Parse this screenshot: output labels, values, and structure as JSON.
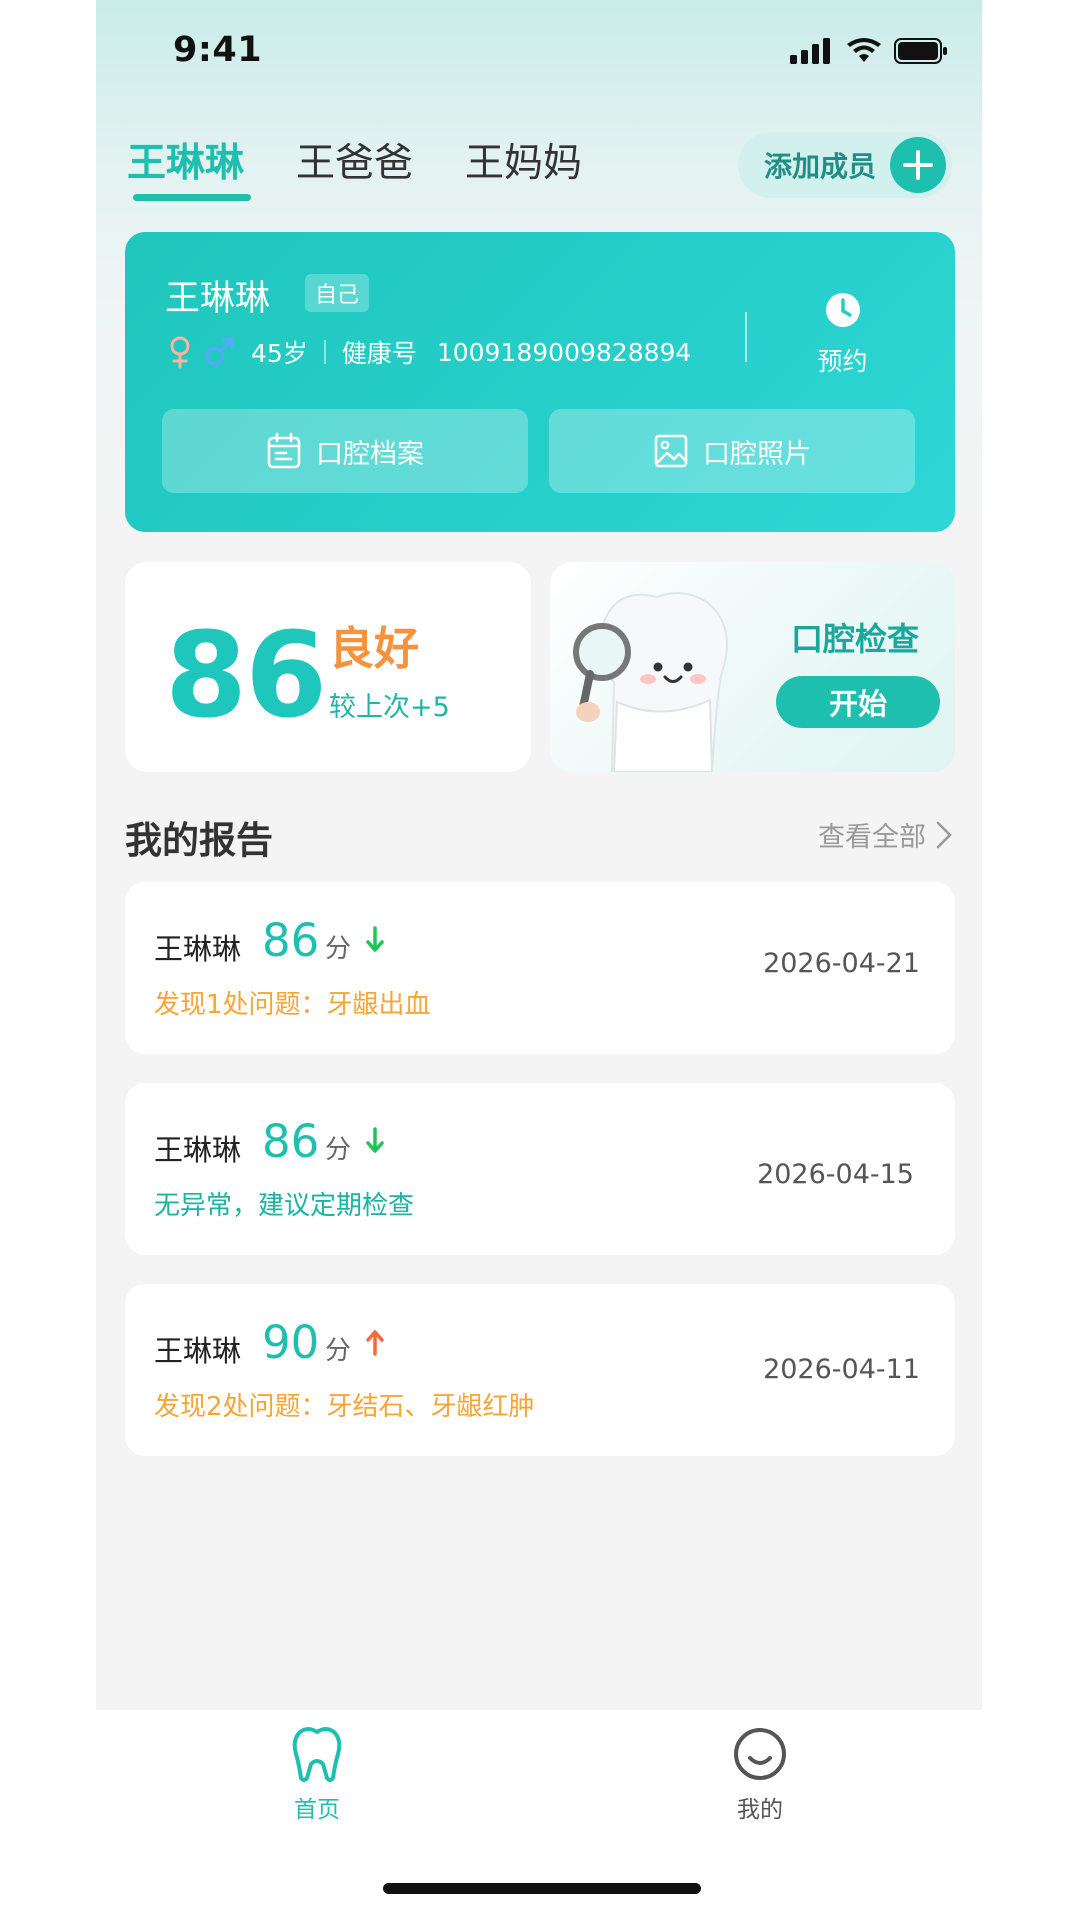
{
  "status_bar": {
    "time": "9:41"
  },
  "tabs": [
    {
      "label": "王琳琳",
      "active": true
    },
    {
      "label": "王爸爸",
      "active": false
    },
    {
      "label": "王妈妈",
      "active": false
    }
  ],
  "add_member": {
    "label": "添加成员"
  },
  "profile": {
    "name": "王琳琳",
    "tag": "自己",
    "age": "45岁",
    "health_label": "健康号",
    "health_number": "1009189009828894",
    "appointment_label": "预约",
    "buttons": {
      "dental_records": "口腔档案",
      "dental_photos": "口腔照片"
    }
  },
  "score": {
    "value": "86",
    "level": "良好",
    "delta": "较上次+5"
  },
  "exam": {
    "title": "口腔检查",
    "start": "开始"
  },
  "reports_section": {
    "title": "我的报告",
    "view_all": "查看全部"
  },
  "reports": [
    {
      "name": "王琳琳",
      "score": "86",
      "unit": "分",
      "trend": "down",
      "desc": "发现1处问题：牙龈出血",
      "date": "2026-04-21",
      "status": "warn"
    },
    {
      "name": "王琳琳",
      "score": "86",
      "unit": "分",
      "trend": "down",
      "desc": "无异常，建议定期检查",
      "date": "2026-04-15",
      "status": "ok"
    },
    {
      "name": "王琳琳",
      "score": "90",
      "unit": "分",
      "trend": "up",
      "desc": "发现2处问题：牙结石、牙龈红肿",
      "date": "2026-04-11",
      "status": "warn"
    }
  ],
  "bottom_nav": [
    {
      "label": "首页",
      "active": true
    },
    {
      "label": "我的",
      "active": false
    }
  ],
  "colors": {
    "accent": "#1fbfb0",
    "warning": "#f7a534",
    "score_level": "#f5923d",
    "down": "#1fc35a",
    "up": "#f56a3a"
  }
}
